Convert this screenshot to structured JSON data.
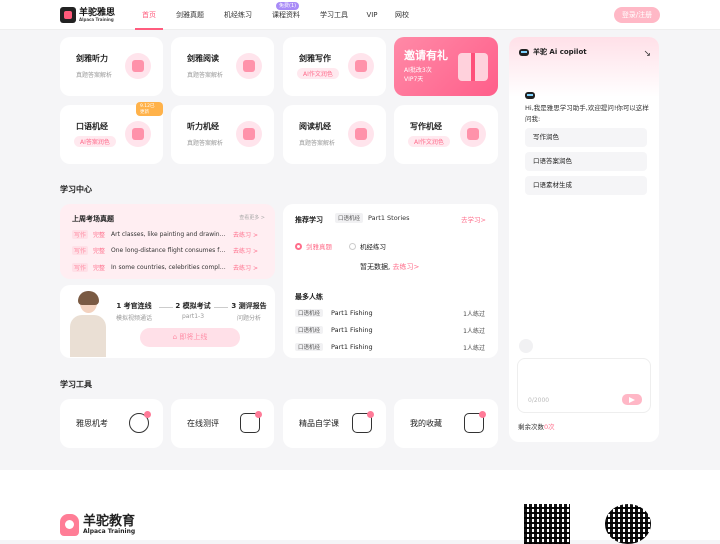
{
  "header": {
    "logo_cn": "羊驼雅思",
    "logo_en": "Alpaca Training",
    "nav": [
      {
        "label": "首页",
        "active": true
      },
      {
        "label": "剑雅真题"
      },
      {
        "label": "机经练习"
      },
      {
        "label": "课程资料",
        "badge": "免费(1)"
      },
      {
        "label": "学习工具"
      },
      {
        "label": "VIP"
      },
      {
        "label": "网校"
      }
    ],
    "login": "登录/注册"
  },
  "tiles": [
    {
      "title": "剑雅听力",
      "sub": "真题答案解析",
      "icon": "headphones-icon"
    },
    {
      "title": "剑雅阅读",
      "sub": "真题答案解析",
      "icon": "book-icon"
    },
    {
      "title": "剑雅写作",
      "pill": "AI作文润色",
      "icon": "pencil-icon"
    },
    {
      "title": "口语机经",
      "pill": "AI答案润色",
      "icon": "chat-hi-icon",
      "hot": "9.12已更新"
    },
    {
      "title": "听力机经",
      "sub": "真题答案解析",
      "icon": "headphones-icon"
    },
    {
      "title": "阅读机经",
      "sub": "真题答案解析",
      "icon": "open-book-icon"
    },
    {
      "title": "写作机经",
      "pill": "AI作文润色",
      "icon": "edit-icon"
    }
  ],
  "promo": {
    "title": "邀请有礼",
    "line1": "AI批改3次",
    "line2": "VIP7天"
  },
  "study_center": {
    "title": "学习中心",
    "weekly": {
      "title": "上周考场真题",
      "more": "查看更多 >",
      "rows": [
        {
          "tag": "写作",
          "tag2": "完整",
          "text": "Art classes, like painting and drawing, are...",
          "go": "去练习 >"
        },
        {
          "tag": "写作",
          "tag2": "完整",
          "text": "One long-distance flight consumes fuel ...",
          "go": "去练习 >"
        },
        {
          "tag": "写作",
          "tag2": "完整",
          "text": "In some countries, celebrities complain ...",
          "go": "去练习 >"
        }
      ]
    },
    "mock": {
      "steps": [
        {
          "title": "1 考官连线",
          "sub": "模拟视频通话"
        },
        {
          "title": "2 模拟考试",
          "sub": "part1-3"
        },
        {
          "title": "3 测评报告",
          "sub": "问题分析"
        }
      ],
      "button": "即将上线"
    },
    "recommend": {
      "title": "推荐学习",
      "tag": "口语机经",
      "part": "Part1 Stories",
      "go": "去学习>",
      "radios": [
        "剑雅真题",
        "机经练习"
      ],
      "nodata": "暂无数据,",
      "nodata_link": "去练习>",
      "practice_title": "最多人练",
      "practice": [
        {
          "tag": "口语机经",
          "name": "Part1 Fishing",
          "count": "1人练过"
        },
        {
          "tag": "口语机经",
          "name": "Part1 Fishing",
          "count": "1人练过"
        },
        {
          "tag": "口语机经",
          "name": "Part1 Fishing",
          "count": "1人练过"
        }
      ]
    }
  },
  "tools": {
    "title": "学习工具",
    "items": [
      {
        "label": "雅思机考",
        "icon": "target-icon"
      },
      {
        "label": "在线测评",
        "icon": "clipboard-icon"
      },
      {
        "label": "精品自学课",
        "icon": "video-icon"
      },
      {
        "label": "我的收藏",
        "icon": "star-folder-icon"
      }
    ]
  },
  "copilot": {
    "title": "羊驼 Ai copilot",
    "greeting": "Hi,我是雅思学习助手,欢迎提问!你可以这样问我:",
    "options": [
      "写作润色",
      "口语答案润色",
      "口语素材生成"
    ],
    "count": "0/2000",
    "left_label": "剩余次数",
    "left_value": "0次"
  },
  "footer": {
    "cn": "羊驼教育",
    "en": "Alpaca Training"
  }
}
